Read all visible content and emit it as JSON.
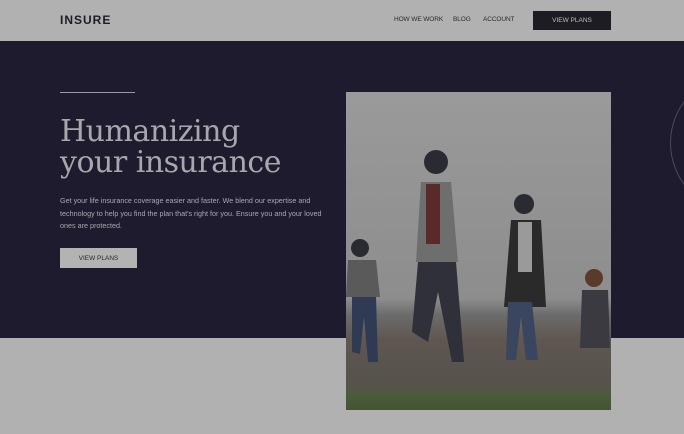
{
  "header": {
    "logo": "INSURE",
    "nav": [
      "HOW WE WORK",
      "BLOG",
      "ACCOUNT"
    ],
    "cta": "VIEW PLANS"
  },
  "hero": {
    "title_line1": "Humanizing",
    "title_line2": "your insurance",
    "description": "Get your life insurance coverage easier and faster. We blend our expertise and technology to help you find the plan that's right for you. Ensure you and your loved ones are protected.",
    "cta": "VIEW PLANS"
  },
  "colors": {
    "dark": "#1f1b2e",
    "overlay": "#b1b1b1"
  }
}
